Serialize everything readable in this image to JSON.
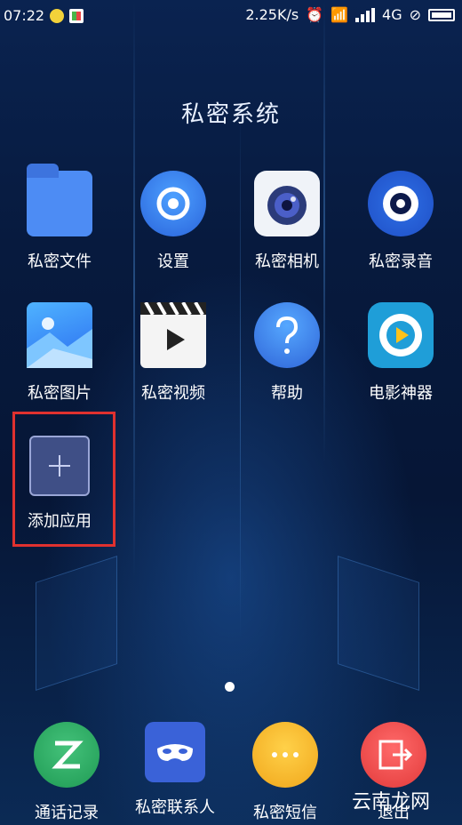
{
  "status_bar": {
    "time": "07:22",
    "speed": "2.25K/s",
    "network": "4G"
  },
  "title": "私密系统",
  "grid": [
    {
      "label": "私密文件",
      "icon": "folder-icon"
    },
    {
      "label": "设置",
      "icon": "gear-icon"
    },
    {
      "label": "私密相机",
      "icon": "camera-icon"
    },
    {
      "label": "私密录音",
      "icon": "recorder-icon"
    },
    {
      "label": "私密图片",
      "icon": "gallery-icon"
    },
    {
      "label": "私密视频",
      "icon": "video-icon"
    },
    {
      "label": "帮助",
      "icon": "help-icon"
    },
    {
      "label": "电影神器",
      "icon": "movie-icon"
    },
    {
      "label": "添加应用",
      "icon": "plus-icon"
    }
  ],
  "dock": [
    {
      "label": "通话记录",
      "icon": "phone-icon"
    },
    {
      "label": "私密联系人",
      "icon": "mask-icon"
    },
    {
      "label": "私密短信",
      "icon": "message-icon"
    },
    {
      "label": "退出",
      "icon": "exit-icon"
    }
  ],
  "watermark": "云南龙网",
  "colors": {
    "highlight": "#e0312f",
    "background": "#071a3e"
  }
}
